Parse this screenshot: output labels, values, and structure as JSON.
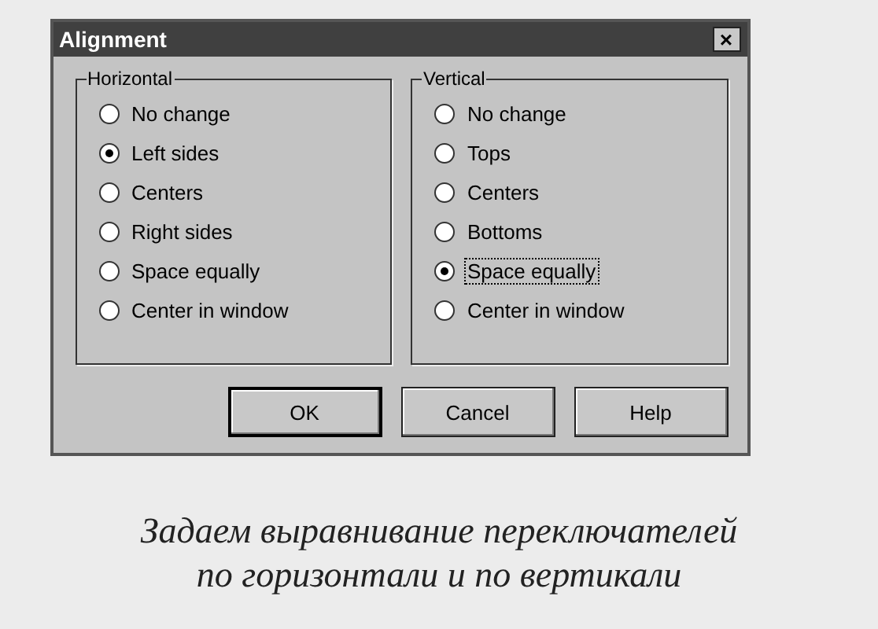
{
  "window": {
    "title": "Alignment",
    "close_label": "×"
  },
  "groups": [
    {
      "title": "Horizontal",
      "options": [
        {
          "label": "No change",
          "selected": false,
          "focused": false
        },
        {
          "label": "Left sides",
          "selected": true,
          "focused": false
        },
        {
          "label": "Centers",
          "selected": false,
          "focused": false
        },
        {
          "label": "Right sides",
          "selected": false,
          "focused": false
        },
        {
          "label": "Space equally",
          "selected": false,
          "focused": false
        },
        {
          "label": "Center in window",
          "selected": false,
          "focused": false
        }
      ]
    },
    {
      "title": "Vertical",
      "options": [
        {
          "label": "No change",
          "selected": false,
          "focused": false
        },
        {
          "label": "Tops",
          "selected": false,
          "focused": false
        },
        {
          "label": "Centers",
          "selected": false,
          "focused": false
        },
        {
          "label": "Bottoms",
          "selected": false,
          "focused": false
        },
        {
          "label": "Space equally",
          "selected": true,
          "focused": true
        },
        {
          "label": "Center in window",
          "selected": false,
          "focused": false
        }
      ]
    }
  ],
  "buttons": [
    "OK",
    "Cancel",
    "Help"
  ],
  "caption": [
    "Задаем выравнивание переключателей",
    "по горизонтали и по вертикали"
  ]
}
